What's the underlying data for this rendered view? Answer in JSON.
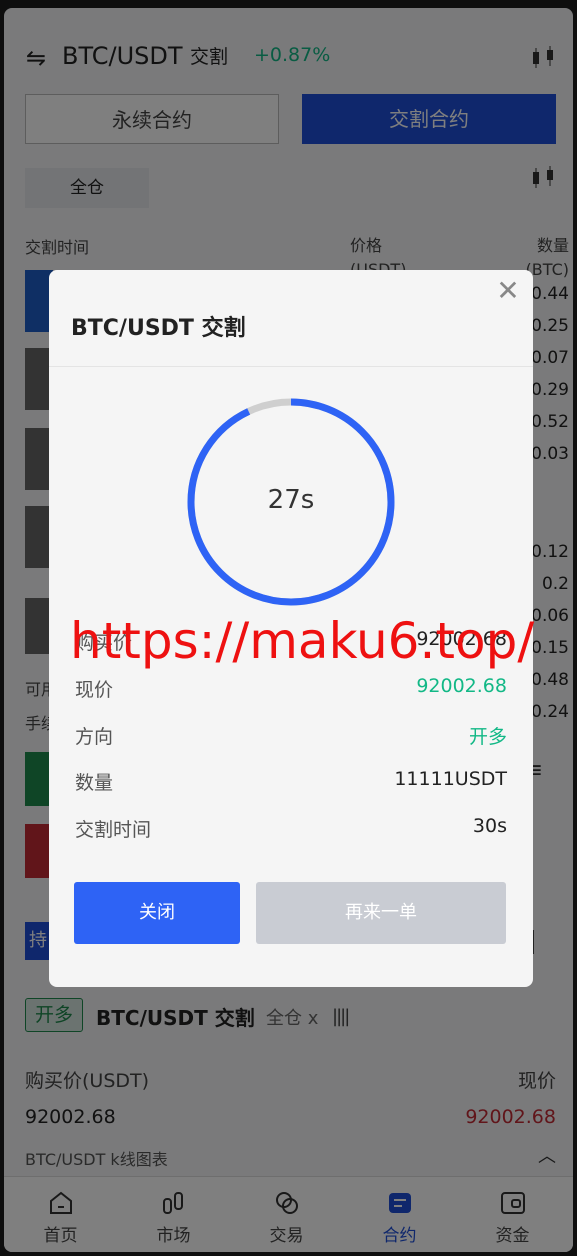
{
  "header": {
    "pair": "BTC/USDT",
    "mode": "交割",
    "change": "+0.87%"
  },
  "tabs": [
    {
      "label": "永续合约"
    },
    {
      "label": "交割合约"
    }
  ],
  "margin_mode": "全仓",
  "orderbook": {
    "col_time": "交割时间",
    "col_price": "价格\n(USDT)",
    "col_qty": "数量\n(BTC)",
    "qty_rows": [
      "0.44",
      "0.25",
      "0.07",
      "0.29",
      "0.52",
      "0.03",
      "0.12",
      "0.2",
      "0.06",
      "0.15",
      "0.48",
      "0.24"
    ]
  },
  "side_labels": {
    "available": "可用",
    "fee": "手续"
  },
  "position": {
    "tab_label": "持",
    "tag": "开多",
    "title": "BTC/USDT 交割",
    "sub": "全仓 x",
    "bars": "||||",
    "buy_label": "购买价(USDT)",
    "cur_label": "现价",
    "buy_value": "92002.68",
    "cur_value": "92002.68",
    "kline_label": "BTC/USDT k线图表"
  },
  "nav": [
    {
      "label": "首页",
      "icon": "home-icon"
    },
    {
      "label": "市场",
      "icon": "market-icon"
    },
    {
      "label": "交易",
      "icon": "trade-icon"
    },
    {
      "label": "合约",
      "icon": "contract-icon"
    },
    {
      "label": "资金",
      "icon": "wallet-icon"
    }
  ],
  "modal": {
    "title": "BTC/USDT 交割",
    "countdown": "27s",
    "countdown_progress": 0.93,
    "rows": [
      {
        "label": "购买价",
        "value": "92002.68"
      },
      {
        "label": "现价",
        "value": "92002.68"
      },
      {
        "label": "方向",
        "value": "开多"
      },
      {
        "label": "数量",
        "value": "11111USDT"
      },
      {
        "label": "交割时间",
        "value": "30s"
      }
    ],
    "close_label": "关闭",
    "again_label": "再来一单"
  },
  "watermark": "https://maku6.top/",
  "colors": {
    "accent": "#2e63f5",
    "up": "#12b886",
    "down": "#c22b35"
  }
}
